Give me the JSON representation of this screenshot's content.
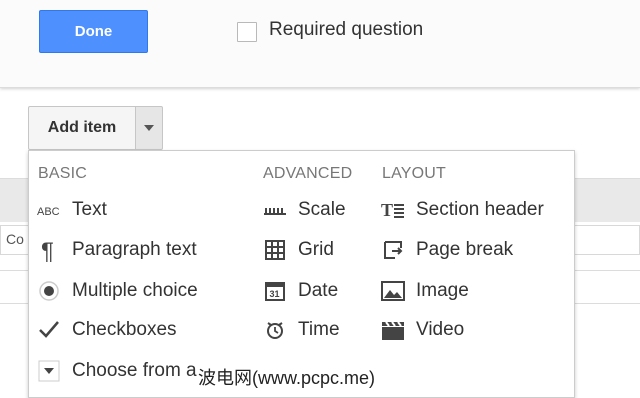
{
  "question": {
    "done_label": "Done",
    "required_label": "Required question"
  },
  "background": {
    "input_prefix": "Co"
  },
  "add_item": {
    "label": "Add item"
  },
  "menu": {
    "basic": {
      "header": "BASIC",
      "items": [
        {
          "label": "Text",
          "icon": "abc-text-icon"
        },
        {
          "label": "Paragraph text",
          "icon": "pilcrow-icon"
        },
        {
          "label": "Multiple choice",
          "icon": "radio-icon"
        },
        {
          "label": "Checkboxes",
          "icon": "checkmark-icon"
        },
        {
          "label": "Choose from a",
          "icon": "dropdown-icon"
        }
      ]
    },
    "advanced": {
      "header": "ADVANCED",
      "items": [
        {
          "label": "Scale",
          "icon": "scale-icon"
        },
        {
          "label": "Grid",
          "icon": "grid-icon"
        },
        {
          "label": "Date",
          "icon": "calendar-icon",
          "glyph": "31"
        },
        {
          "label": "Time",
          "icon": "clock-icon"
        }
      ]
    },
    "layout": {
      "header": "LAYOUT",
      "items": [
        {
          "label": "Section header",
          "icon": "section-header-icon",
          "glyph": "T"
        },
        {
          "label": "Page break",
          "icon": "page-break-icon"
        },
        {
          "label": "Image",
          "icon": "image-icon"
        },
        {
          "label": "Video",
          "icon": "video-icon"
        }
      ]
    }
  },
  "watermark": "波电网(www.pcpc.me)"
}
